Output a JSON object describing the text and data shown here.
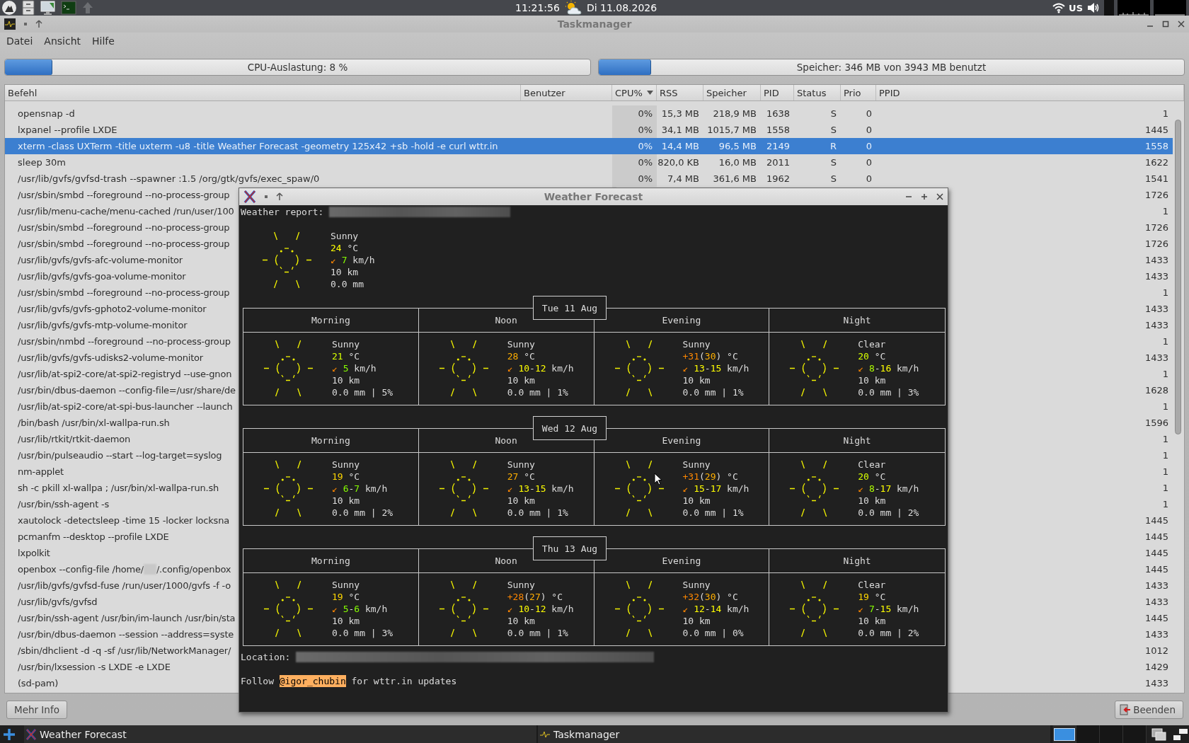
{
  "top_panel": {
    "clock": "11:21:56",
    "date": "Di 11.08.2026",
    "keyboard_layout": "US"
  },
  "taskmanager": {
    "title": "Taskmanager",
    "menu": [
      "Datei",
      "Ansicht",
      "Hilfe"
    ],
    "meters": [
      {
        "label": "CPU-Auslastung: 8 %",
        "level": 0.08
      },
      {
        "label": "Speicher: 346 MB von 3943 MB benutzt",
        "level": 0.088
      }
    ],
    "columns": [
      {
        "label": "Befehl",
        "sorted": false
      },
      {
        "label": "Benutzer",
        "sorted": false
      },
      {
        "label": "CPU%",
        "sorted": true
      },
      {
        "label": "RSS",
        "sorted": false
      },
      {
        "label": "Speicher",
        "sorted": false
      },
      {
        "label": "PID",
        "sorted": false
      },
      {
        "label": "Status",
        "sorted": false
      },
      {
        "label": "Prio",
        "sorted": false
      },
      {
        "label": "PPID",
        "sorted": false
      }
    ],
    "rows": [
      {
        "command": "opensnap -d",
        "cpu": "0%",
        "rss": "15,3 MB",
        "memory": "218,9 MB",
        "pid": "1638",
        "status": "S",
        "prio": "0",
        "ppid": "1",
        "selected": false
      },
      {
        "command": "lxpanel --profile LXDE",
        "cpu": "0%",
        "rss": "34,1 MB",
        "memory": "1015,7 MB",
        "pid": "1558",
        "status": "S",
        "prio": "0",
        "ppid": "1445",
        "selected": false
      },
      {
        "command": "xterm -class UXTerm -title uxterm -u8 -title Weather Forecast -geometry 125x42 +sb -hold -e curl wttr.in",
        "cpu": "0%",
        "rss": "14,4 MB",
        "memory": "96,5 MB",
        "pid": "2149",
        "status": "R",
        "prio": "0",
        "ppid": "1558",
        "selected": true
      },
      {
        "command": "sleep 30m",
        "cpu": "0%",
        "rss": "820,0 KB",
        "memory": "16,0 MB",
        "pid": "2011",
        "status": "S",
        "prio": "0",
        "ppid": "1622",
        "selected": false
      },
      {
        "command": "/usr/lib/gvfs/gvfsd-trash --spawner :1.5 /org/gtk/gvfs/exec_spaw/0",
        "cpu": "0%",
        "rss": "7,4 MB",
        "memory": "361,6 MB",
        "pid": "1962",
        "status": "S",
        "prio": "0",
        "ppid": "1541",
        "selected": false
      },
      {
        "command": "/usr/sbin/smbd --foreground --no-process-group",
        "ppid": "1726",
        "selected": false
      },
      {
        "command": "/usr/lib/menu-cache/menu-cached /run/user/100",
        "ppid": "1",
        "selected": false
      },
      {
        "command": "/usr/sbin/smbd --foreground --no-process-group",
        "ppid": "1726",
        "selected": false
      },
      {
        "command": "/usr/sbin/smbd --foreground --no-process-group",
        "ppid": "1726",
        "selected": false
      },
      {
        "command": "/usr/lib/gvfs/gvfs-afc-volume-monitor",
        "ppid": "1433",
        "selected": false
      },
      {
        "command": "/usr/lib/gvfs/gvfs-goa-volume-monitor",
        "ppid": "1433",
        "selected": false
      },
      {
        "command": "/usr/sbin/smbd --foreground --no-process-group",
        "ppid": "1",
        "selected": false
      },
      {
        "command": "/usr/lib/gvfs/gvfs-gphoto2-volume-monitor",
        "ppid": "1433",
        "selected": false
      },
      {
        "command": "/usr/lib/gvfs/gvfs-mtp-volume-monitor",
        "ppid": "1433",
        "selected": false
      },
      {
        "command": "/usr/sbin/nmbd --foreground --no-process-group",
        "ppid": "1",
        "selected": false
      },
      {
        "command": "/usr/lib/gvfs/gvfs-udisks2-volume-monitor",
        "ppid": "1433",
        "selected": false
      },
      {
        "command": "/usr/lib/at-spi2-core/at-spi2-registryd --use-gnon",
        "ppid": "1",
        "selected": false
      },
      {
        "command": "/usr/bin/dbus-daemon --config-file=/usr/share/de",
        "ppid": "1628",
        "selected": false
      },
      {
        "command": "/usr/lib/at-spi2-core/at-spi-bus-launcher --launch",
        "ppid": "1",
        "selected": false
      },
      {
        "command": "/bin/bash /usr/bin/xl-wallpa-run.sh",
        "ppid": "1596",
        "selected": false
      },
      {
        "command": "/usr/lib/rtkit/rtkit-daemon",
        "ppid": "1",
        "selected": false
      },
      {
        "command": "/usr/bin/pulseaudio --start --log-target=syslog",
        "ppid": "1",
        "selected": false
      },
      {
        "command": "nm-applet",
        "ppid": "1",
        "selected": false
      },
      {
        "command": "sh -c pkill xl-wallpa ; /usr/bin/xl-wallpa-run.sh",
        "ppid": "1",
        "selected": false
      },
      {
        "command": "/usr/bin/ssh-agent -s",
        "ppid": "1",
        "selected": false
      },
      {
        "command": "xautolock -detectsleep -time 15 -locker locksna",
        "ppid": "1445",
        "selected": false
      },
      {
        "command": "pcmanfm --desktop --profile LXDE",
        "ppid": "1445",
        "selected": false
      },
      {
        "command": "lxpolkit",
        "ppid": "1445",
        "selected": false
      },
      {
        "command": "openbox --config-file /home/",
        "command_after_redaction": "/.config/openbox",
        "ppid": "1445",
        "selected": false
      },
      {
        "command": "/usr/lib/gvfs/gvfsd-fuse /run/user/1000/gvfs -f -o",
        "ppid": "1433",
        "selected": false
      },
      {
        "command": "/usr/lib/gvfs/gvfsd",
        "ppid": "1433",
        "selected": false
      },
      {
        "command": "/usr/bin/ssh-agent /usr/bin/im-launch /usr/bin/sta",
        "ppid": "1445",
        "selected": false
      },
      {
        "command": "/usr/bin/dbus-daemon --session --address=syste",
        "ppid": "1433",
        "selected": false
      },
      {
        "command": "/sbin/dhclient -d -q -sf /usr/lib/NetworkManager/",
        "ppid": "1012",
        "selected": false
      },
      {
        "command": "/usr/bin/lxsession -s LXDE -e LXDE",
        "ppid": "1429",
        "selected": false
      },
      {
        "command": "(sd-pam)",
        "ppid": "1433",
        "selected": false
      }
    ],
    "buttons": [
      {
        "label": "Mehr Info",
        "kind": "info"
      },
      {
        "label": "Beenden",
        "kind": "kill"
      }
    ]
  },
  "weather_window": {
    "title": "Weather Forecast",
    "report_label": "Weather report:",
    "current": {
      "condition": "Sunny",
      "temp": [
        {
          "text": "24",
          "color": "#ffff00"
        }
      ],
      "temp_unit": "°C",
      "wind_arrow": "↙",
      "wind": [
        {
          "text": "7",
          "color": "#87ff00"
        }
      ],
      "wind_unit": "km/h",
      "visibility": "10 km",
      "precip": "0.0 mm"
    },
    "days": [
      {
        "date": "Tue 11 Aug",
        "periods": [
          {
            "name": "Morning",
            "condition": "Sunny",
            "temp": [
              {
                "text": "21",
                "color": "#d7ff00"
              }
            ],
            "temp_unit": "°C",
            "wind_arrow": "↙",
            "wind": [
              {
                "text": "5",
                "color": "#87ff00"
              }
            ],
            "wind_unit": "km/h",
            "visibility": "10 km",
            "precip": "0.0 mm | 5%"
          },
          {
            "name": "Noon",
            "condition": "Sunny",
            "temp": [
              {
                "text": "28",
                "color": "#ffaf00"
              }
            ],
            "temp_unit": "°C",
            "wind_arrow": "↙",
            "wind": [
              {
                "text": "10",
                "color": "#ffff00"
              },
              {
                "text": "-"
              },
              {
                "text": "12",
                "color": "#ffff00"
              }
            ],
            "wind_unit": "km/h",
            "visibility": "10 km",
            "precip": "0.0 mm | 1%"
          },
          {
            "name": "Evening",
            "condition": "Sunny",
            "temp": [
              {
                "text": "+31",
                "color": "#ff8700"
              },
              {
                "text": "("
              },
              {
                "text": "30",
                "color": "#ffaf00"
              },
              {
                "text": ")"
              }
            ],
            "temp_unit": "°C",
            "wind_arrow": "↙",
            "wind": [
              {
                "text": "13",
                "color": "#ffff00"
              },
              {
                "text": "-"
              },
              {
                "text": "15",
                "color": "#ffff00"
              }
            ],
            "wind_unit": "km/h",
            "visibility": "10 km",
            "precip": "0.0 mm | 1%"
          },
          {
            "name": "Night",
            "condition": "Clear",
            "temp": [
              {
                "text": "20",
                "color": "#d7ff00"
              }
            ],
            "temp_unit": "°C",
            "wind_arrow": "↙",
            "wind": [
              {
                "text": "8",
                "color": "#afff00"
              },
              {
                "text": "-"
              },
              {
                "text": "16",
                "color": "#ffff00"
              }
            ],
            "wind_unit": "km/h",
            "visibility": "10 km",
            "precip": "0.0 mm | 3%"
          }
        ]
      },
      {
        "date": "Wed 12 Aug",
        "periods": [
          {
            "name": "Morning",
            "condition": "Sunny",
            "temp": [
              {
                "text": "19",
                "color": "#ffd700"
              }
            ],
            "temp_unit": "°C",
            "wind_arrow": "↙",
            "wind": [
              {
                "text": "6",
                "color": "#87ff00"
              },
              {
                "text": "-"
              },
              {
                "text": "7",
                "color": "#87ff00"
              }
            ],
            "wind_unit": "km/h",
            "visibility": "10 km",
            "precip": "0.0 mm | 2%"
          },
          {
            "name": "Noon",
            "condition": "Sunny",
            "temp": [
              {
                "text": "27",
                "color": "#ffaf00"
              }
            ],
            "temp_unit": "°C",
            "wind_arrow": "↙",
            "wind": [
              {
                "text": "13",
                "color": "#ffff00"
              },
              {
                "text": "-"
              },
              {
                "text": "15",
                "color": "#ffff00"
              }
            ],
            "wind_unit": "km/h",
            "visibility": "10 km",
            "precip": "0.0 mm | 1%"
          },
          {
            "name": "Evening",
            "condition": "Sunny",
            "temp": [
              {
                "text": "+31",
                "color": "#ff8700"
              },
              {
                "text": "("
              },
              {
                "text": "29",
                "color": "#ffaf00"
              },
              {
                "text": ")"
              }
            ],
            "temp_unit": "°C",
            "wind_arrow": "↙",
            "wind": [
              {
                "text": "15",
                "color": "#ffff00"
              },
              {
                "text": "-"
              },
              {
                "text": "17",
                "color": "#ffff00"
              }
            ],
            "wind_unit": "km/h",
            "visibility": "10 km",
            "precip": "0.0 mm | 1%"
          },
          {
            "name": "Night",
            "condition": "Clear",
            "temp": [
              {
                "text": "20",
                "color": "#d7ff00"
              }
            ],
            "temp_unit": "°C",
            "wind_arrow": "↙",
            "wind": [
              {
                "text": "8",
                "color": "#afff00"
              },
              {
                "text": "-"
              },
              {
                "text": "17",
                "color": "#ffff00"
              }
            ],
            "wind_unit": "km/h",
            "visibility": "10 km",
            "precip": "0.0 mm | 2%"
          }
        ]
      },
      {
        "date": "Thu 13 Aug",
        "periods": [
          {
            "name": "Morning",
            "condition": "Sunny",
            "temp": [
              {
                "text": "19",
                "color": "#ffd700"
              }
            ],
            "temp_unit": "°C",
            "wind_arrow": "↙",
            "wind": [
              {
                "text": "5",
                "color": "#87ff00"
              },
              {
                "text": "-"
              },
              {
                "text": "6",
                "color": "#87ff00"
              }
            ],
            "wind_unit": "km/h",
            "visibility": "10 km",
            "precip": "0.0 mm | 3%"
          },
          {
            "name": "Noon",
            "condition": "Sunny",
            "temp": [
              {
                "text": "+28",
                "color": "#ff8700"
              },
              {
                "text": "("
              },
              {
                "text": "27",
                "color": "#ffaf00"
              },
              {
                "text": ")"
              }
            ],
            "temp_unit": "°C",
            "wind_arrow": "↙",
            "wind": [
              {
                "text": "10",
                "color": "#ffff00"
              },
              {
                "text": "-"
              },
              {
                "text": "12",
                "color": "#ffff00"
              }
            ],
            "wind_unit": "km/h",
            "visibility": "10 km",
            "precip": "0.0 mm | 1%"
          },
          {
            "name": "Evening",
            "condition": "Sunny",
            "temp": [
              {
                "text": "+32",
                "color": "#ff8700"
              },
              {
                "text": "("
              },
              {
                "text": "30",
                "color": "#ffaf00"
              },
              {
                "text": ")"
              }
            ],
            "temp_unit": "°C",
            "wind_arrow": "↙",
            "wind": [
              {
                "text": "12",
                "color": "#ffff00"
              },
              {
                "text": "-"
              },
              {
                "text": "14",
                "color": "#ffff00"
              }
            ],
            "wind_unit": "km/h",
            "visibility": "10 km",
            "precip": "0.0 mm | 0%"
          },
          {
            "name": "Night",
            "condition": "Clear",
            "temp": [
              {
                "text": "19",
                "color": "#ffd700"
              }
            ],
            "temp_unit": "°C",
            "wind_arrow": "↙",
            "wind": [
              {
                "text": "7",
                "color": "#87ff00"
              },
              {
                "text": "-"
              },
              {
                "text": "15",
                "color": "#ffff00"
              }
            ],
            "wind_unit": "km/h",
            "visibility": "10 km",
            "precip": "0.0 mm | 2%"
          }
        ]
      }
    ],
    "location_label": "Location:",
    "follow": {
      "before": "Follow",
      "handle": "@igor_chubin",
      "after": "for wttr.in updates"
    }
  },
  "taskbar": {
    "tasks": [
      {
        "label": "Weather Forecast",
        "kind": "xterm"
      },
      {
        "label": "Taskmanager",
        "kind": "taskmanager"
      }
    ],
    "desktops": [
      {
        "selected": true
      },
      {
        "selected": false
      },
      {
        "selected": false
      },
      {
        "selected": false
      }
    ]
  }
}
